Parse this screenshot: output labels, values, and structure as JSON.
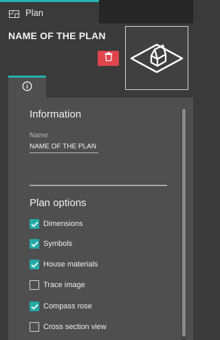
{
  "window": {
    "tab_label": "Plan",
    "tab_icon": "floor-plan-icon"
  },
  "header": {
    "plan_name": "NAME OF THE PLAN",
    "delete_icon": "trash-icon",
    "thumbnail_icon": "house-3d-icon"
  },
  "info_tab": {
    "icon": "info-icon"
  },
  "information": {
    "title": "Information",
    "name_label": "Name",
    "name_value": "NAME OF THE PLAN"
  },
  "plan_options": {
    "title": "Plan options",
    "items": [
      {
        "label": "Dimensions",
        "checked": true
      },
      {
        "label": "Symbols",
        "checked": true
      },
      {
        "label": "House materials",
        "checked": true
      },
      {
        "label": "Trace image",
        "checked": false
      },
      {
        "label": "Compass rose",
        "checked": true
      },
      {
        "label": "Cross section view",
        "checked": false
      }
    ]
  },
  "colors": {
    "accent": "#23b3b0",
    "delete": "#e0454d",
    "background": "#3a3a3a",
    "panel": "#4f4f4f"
  }
}
